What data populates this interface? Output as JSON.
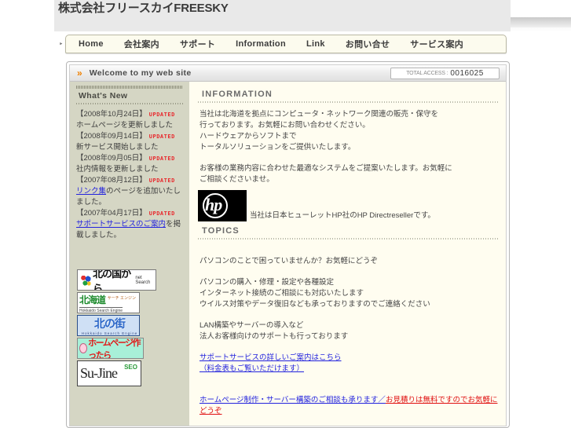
{
  "header": {
    "site_title": "株式会社フリースカイFREESKY"
  },
  "nav": {
    "items": [
      {
        "label": "Home"
      },
      {
        "label": "会社案内"
      },
      {
        "label": "サポート"
      },
      {
        "label": "Information"
      },
      {
        "label": "Link"
      },
      {
        "label": "お問い合せ"
      },
      {
        "label": "サービス案内"
      }
    ],
    "tab_marker": "‣"
  },
  "welcome": {
    "arrows": "»",
    "title": "Welcome to my web site",
    "access_label": "TOTAL ACCESS :",
    "access_count": "0016025"
  },
  "sidebar": {
    "heading": "What's New",
    "news": [
      {
        "date": "【2008年10月24日】",
        "updated": "UPDATED",
        "body": "ホームページを更新しました",
        "is_link": false
      },
      {
        "date": "【2008年09月14日】",
        "updated": "UPDATED",
        "body": "新サービス開始しました",
        "is_link": false
      },
      {
        "date": "【2008年09月05日】",
        "updated": "UPDATED",
        "body": "社内情報を更新しました",
        "is_link": false
      },
      {
        "date": "【2007年08月12日】",
        "updated": "UPDATED",
        "body_link": "リンク集",
        "body_rest": "のページを追加いたしました。",
        "is_link": true
      },
      {
        "date": "【2007年04月17日】",
        "updated": "UPDATED",
        "body_link": "サポートサービスのご案内",
        "body_rest": "を掲載しました。",
        "is_link": true
      }
    ],
    "spacer_lines": [
      "　",
      "　"
    ],
    "banners": [
      {
        "name": "kitanokunikara-net-search",
        "jp": "北の国から",
        "en": "net Search"
      },
      {
        "name": "hokkaido-search-engine",
        "jp": "北海道",
        "sub": "サーチ\nエンジン",
        "en": "Hokkaido Search Engine"
      },
      {
        "name": "kitanomachi",
        "jp": "北の街",
        "en": "Hokkaido Search Engine"
      },
      {
        "name": "homepage-tsukuttara",
        "jp": "ホームページ作ったら"
      },
      {
        "name": "su-jine-seo",
        "text": "Su-Jine",
        "badge": "SEO"
      }
    ]
  },
  "content": {
    "information": {
      "heading": "INFORMATION",
      "paragraphs": [
        {
          "lines": [
            "当社は北海道を拠点にコンピュータ・ネットワーク関連の販売・保守を",
            "行っております。お気軽にお問い合わせください。",
            "ハードウェアからソフトまで",
            "トータルソリューションをご提供いたします。"
          ]
        },
        {
          "lines": [
            "お客様の業務内容に合わせた最適なシステムをご提案いたします。お気軽に",
            "ご相談くださいませ。"
          ]
        }
      ],
      "hp_caption": "当社は日本ヒューレットHP社のHP Directresellerです。"
    },
    "topics": {
      "heading": "TOPICS",
      "blocks": [
        {
          "lines": [
            "パソコンのことで困っていませんか？お気軽にどうぞ"
          ]
        },
        {
          "lines": [
            "パソコンの購入・修理・設定や各種設定",
            "インターネット接続のご相談にも対応いたします",
            "ウイルス対策やデータ復旧なども承っておりますのでご連絡ください"
          ]
        },
        {
          "lines": [
            "LAN構築やサーバーの導入など",
            "法人お客様向けのサポートも行っております"
          ]
        }
      ],
      "links": [
        {
          "lines": [
            "サポートサービスの詳しいご案内はこちら",
            "（料金表もご覧いただけます）"
          ]
        }
      ],
      "footer_link": {
        "blue": "ホームページ制作・サーバー構築のご相談も承ります／",
        "red": "お見積りは無料ですのでお気軽にどうぞ"
      }
    }
  }
}
